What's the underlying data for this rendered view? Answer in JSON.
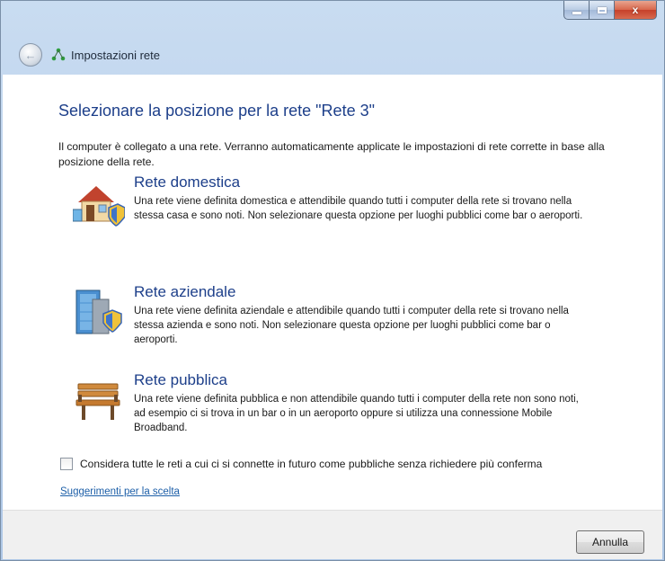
{
  "window": {
    "title": "Impostazioni rete",
    "controls": {
      "minimize": "minimize",
      "maximize": "maximize",
      "close": "x"
    }
  },
  "page": {
    "heading": "Selezionare la posizione per la rete \"Rete  3\"",
    "intro": "Il computer è collegato a una rete. Verranno automaticamente applicate le impostazioni di rete corrette in base alla posizione della rete."
  },
  "options": [
    {
      "title": "Rete domestica",
      "description": "Una rete viene definita domestica e attendibile quando tutti i computer della rete si trovano nella stessa casa e sono noti. Non selezionare questa opzione per luoghi pubblici come bar o aeroporti.",
      "icon": "home-network-icon"
    },
    {
      "title": "Rete aziendale",
      "description": "Una rete viene definita aziendale e attendibile quando tutti i computer della rete si trovano nella stessa azienda e sono noti. Non selezionare questa opzione per luoghi pubblici come bar o aeroporti.",
      "icon": "work-network-icon"
    },
    {
      "title": "Rete pubblica",
      "description": "Una rete viene definita pubblica e non attendibile quando tutti i computer della rete non sono noti, ad esempio ci si trova in un bar o in un aeroporto oppure si utilizza una connessione Mobile Broadband.",
      "icon": "public-network-icon"
    }
  ],
  "checkbox": {
    "label": "Considera tutte le reti a cui ci si connette in futuro come pubbliche senza richiedere più conferma",
    "checked": false
  },
  "help_link": "Suggerimenti per la scelta",
  "footer": {
    "cancel_label": "Annulla"
  },
  "colors": {
    "heading": "#1d3f8a",
    "link": "#1d5fa8",
    "chrome": "#bcd2ec",
    "footer": "#f0f0f0"
  }
}
